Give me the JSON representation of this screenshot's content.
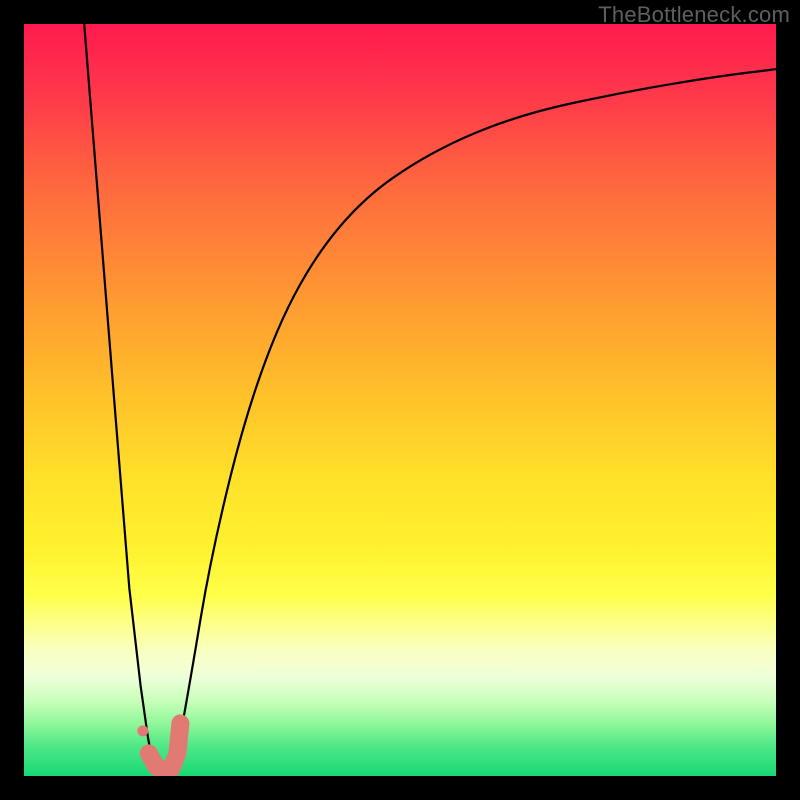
{
  "watermark": "TheBottleneck.com",
  "gradient_stops": [
    {
      "offset": 0.0,
      "color": "#ff1a4f"
    },
    {
      "offset": 0.1,
      "color": "#ff3a4a"
    },
    {
      "offset": 0.22,
      "color": "#ff6a3e"
    },
    {
      "offset": 0.35,
      "color": "#ff9433"
    },
    {
      "offset": 0.48,
      "color": "#ffbd2a"
    },
    {
      "offset": 0.6,
      "color": "#ffe02a"
    },
    {
      "offset": 0.7,
      "color": "#fff22f"
    },
    {
      "offset": 0.76,
      "color": "#ffff4a"
    },
    {
      "offset": 0.8,
      "color": "#fdff8f"
    },
    {
      "offset": 0.84,
      "color": "#f8ffc8"
    },
    {
      "offset": 0.87,
      "color": "#edffd8"
    },
    {
      "offset": 0.9,
      "color": "#c8ffba"
    },
    {
      "offset": 0.93,
      "color": "#90f79a"
    },
    {
      "offset": 0.96,
      "color": "#4fe887"
    },
    {
      "offset": 1.0,
      "color": "#18d974"
    }
  ],
  "curve_color": "#000000",
  "curve_width": 2.2,
  "marker": {
    "color": "#e27a74",
    "stroke": "#c95f59"
  },
  "chart_data": {
    "type": "line",
    "title": "",
    "xlabel": "",
    "ylabel": "",
    "xlim": [
      0,
      100
    ],
    "ylim": [
      0,
      100
    ],
    "annotations": [],
    "series": [
      {
        "name": "left-branch",
        "x": [
          8,
          10,
          12,
          14,
          15.5,
          16.5,
          17.3
        ],
        "y": [
          100,
          75,
          50,
          25,
          12,
          5,
          1
        ]
      },
      {
        "name": "right-branch",
        "x": [
          20,
          22,
          25,
          30,
          36,
          44,
          54,
          66,
          80,
          92,
          100
        ],
        "y": [
          1,
          12,
          30,
          50,
          65,
          76,
          83,
          88,
          91,
          93,
          94
        ]
      }
    ],
    "markers": {
      "name": "highlight-points",
      "x": [
        15.8,
        16.6,
        17.6,
        18.6,
        19.6,
        20.4,
        20.8
      ],
      "y": [
        6.0,
        3.0,
        1.2,
        0.8,
        1.0,
        3.0,
        7.0
      ]
    },
    "background": "vertical-gradient red→yellow→green (top→bottom)"
  }
}
